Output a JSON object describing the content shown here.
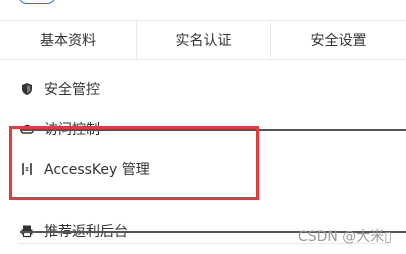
{
  "tabs": [
    {
      "label": "基本资料"
    },
    {
      "label": "实名认证"
    },
    {
      "label": "安全设置"
    }
  ],
  "menu": {
    "items": [
      {
        "label": "安全管控",
        "icon": "shield-icon"
      },
      {
        "label": "访问控制",
        "icon": "cloud-icon"
      },
      {
        "label": "AccessKey 管理",
        "icon": "key-bracket-icon"
      },
      {
        "label": "推荐返利后台",
        "icon": "printer-icon"
      }
    ]
  },
  "watermark": "CSDN @大米▯",
  "colors": {
    "highlight_border": "#e23b3b",
    "accent": "#2f6fd8",
    "divider": "#e8e8e8"
  }
}
